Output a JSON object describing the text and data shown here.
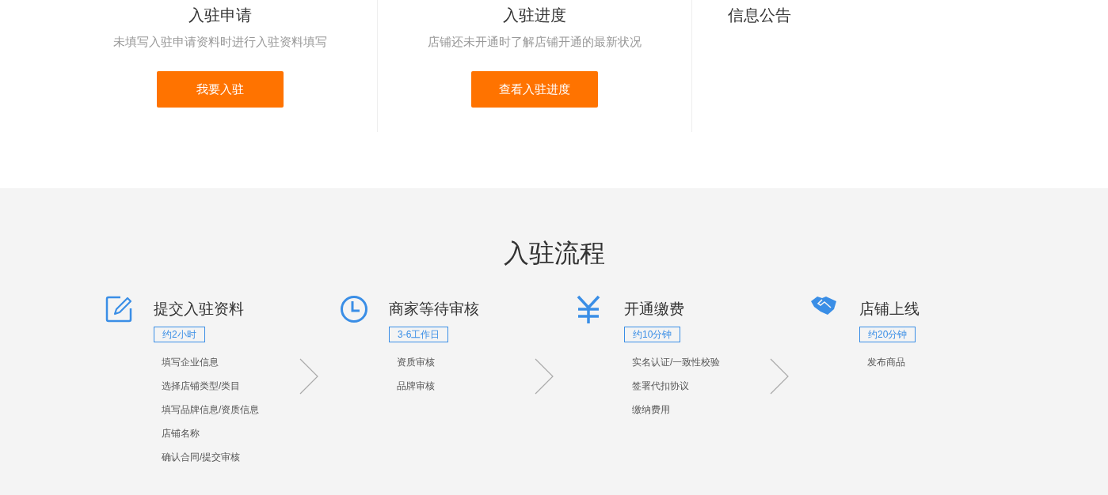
{
  "cards": [
    {
      "title": "入驻申请",
      "description": "未填写入驻申请资料时进行入驻资料填写",
      "button": "我要入驻"
    },
    {
      "title": "入驻进度",
      "description": "店铺还未开通时了解店铺开通的最新状况",
      "button": "查看入驻进度"
    }
  ],
  "notice": {
    "title": "信息公告"
  },
  "process": {
    "title": "入驻流程",
    "steps": [
      {
        "title": "提交入驻资料",
        "duration": "约2小时",
        "items": [
          "填写企业信息",
          "选择店铺类型/类目",
          "填写品牌信息/资质信息",
          "店铺名称",
          "确认合同/提交审核"
        ]
      },
      {
        "title": "商家等待审核",
        "duration": "3-6工作日",
        "items": [
          "资质审核",
          "品牌审核"
        ]
      },
      {
        "title": "开通缴费",
        "duration": "约10分钟",
        "items": [
          "实名认证/一致性校验",
          "签署代扣协议",
          "缴纳费用"
        ]
      },
      {
        "title": "店铺上线",
        "duration": "约20分钟",
        "items": [
          "发布商品"
        ]
      }
    ]
  }
}
